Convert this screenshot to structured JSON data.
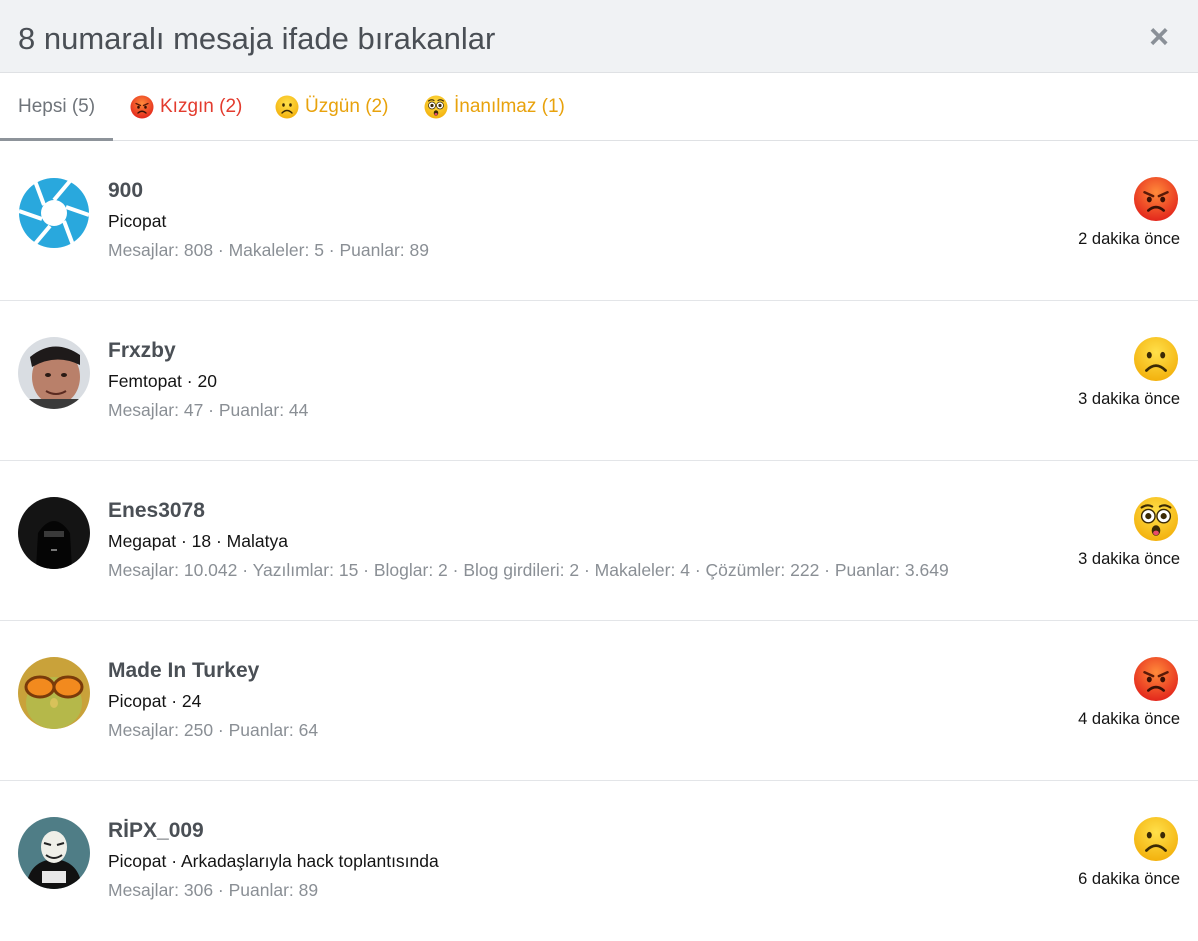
{
  "dialog": {
    "title": "8 numaralı mesaja ifade bırakanlar",
    "close_label": "×"
  },
  "tabs": [
    {
      "label": "Hepsi (5)",
      "active": true
    },
    {
      "label": "Kızgın (2)",
      "icon": "angry-emoji",
      "color": "#e33b2e"
    },
    {
      "label": "Üzgün (2)",
      "icon": "sad-emoji",
      "color": "#e8a20c"
    },
    {
      "label": "İnanılmaz (1)",
      "icon": "astonished-emoji",
      "color": "#e8a20c"
    }
  ],
  "users": [
    {
      "name": "900",
      "title": "Picopat",
      "stats": "Mesajlar: 808 · Makaleler: 5 · Puanlar: 89",
      "reaction": "angry-emoji",
      "time": "2 dakika önce",
      "avatar": "aperture-logo"
    },
    {
      "name": "Frxzby",
      "title": "Femtopat · 20",
      "stats": "Mesajlar: 47 · Puanlar: 44",
      "reaction": "sad-emoji",
      "time": "3 dakika önce",
      "avatar": "photo"
    },
    {
      "name": "Enes3078",
      "title": "Megapat · 18 · Malatya",
      "stats": "Mesajlar: 10.042 · Yazılımlar: 15 · Bloglar: 2 · Blog girdileri: 2 · Makaleler: 4 · Çözümler: 222 · Puanlar: 3.649",
      "reaction": "astonished-emoji",
      "time": "3 dakika önce",
      "avatar": "photo"
    },
    {
      "name": "Made In Turkey",
      "title": "Picopat · 24",
      "stats": "Mesajlar: 250 · Puanlar: 64",
      "reaction": "angry-emoji",
      "time": "4 dakika önce",
      "avatar": "photo"
    },
    {
      "name": "RİPX_009",
      "title": "Picopat · Arkadaşlarıyla hack toplantısında",
      "stats": "Mesajlar: 306 · Puanlar: 89",
      "reaction": "sad-emoji",
      "time": "6 dakika önce",
      "avatar": "photo"
    }
  ]
}
